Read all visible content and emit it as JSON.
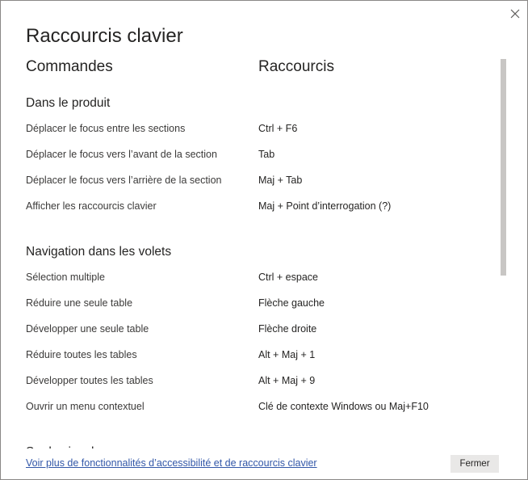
{
  "dialog": {
    "title": "Raccourcis clavier",
    "close_icon": "close-icon"
  },
  "columns": {
    "commands": "Commandes",
    "shortcuts": "Raccourcis"
  },
  "sections": [
    {
      "title": "Dans le produit",
      "rows": [
        {
          "command": "Déplacer le focus entre les sections",
          "shortcut": "Ctrl + F6"
        },
        {
          "command": "Déplacer le focus vers l’avant de la section",
          "shortcut": "Tab"
        },
        {
          "command": "Déplacer le focus vers l’arrière de la section",
          "shortcut": "Maj + Tab"
        },
        {
          "command": "Afficher les raccourcis clavier",
          "shortcut": "Maj + Point d’interrogation (?)"
        }
      ]
    },
    {
      "title": "Navigation dans les volets",
      "rows": [
        {
          "command": "Sélection multiple",
          "shortcut": "Ctrl + espace"
        },
        {
          "command": "Réduire une seule table",
          "shortcut": "Flèche gauche"
        },
        {
          "command": "Développer une seule table",
          "shortcut": "Flèche droite"
        },
        {
          "command": "Réduire toutes les tables",
          "shortcut": "Alt + Maj + 1"
        },
        {
          "command": "Développer toutes les tables",
          "shortcut": "Alt + Maj + 9"
        },
        {
          "command": "Ouvrir un menu contextuel",
          "shortcut": "Clé de contexte Windows ou Maj+F10"
        }
      ]
    },
    {
      "title": "Sur le visuel",
      "rows": []
    }
  ],
  "footer": {
    "link_text": "Voir plus de fonctionnalités d’accessibilité et de raccourcis clavier",
    "close_label": "Fermer"
  }
}
